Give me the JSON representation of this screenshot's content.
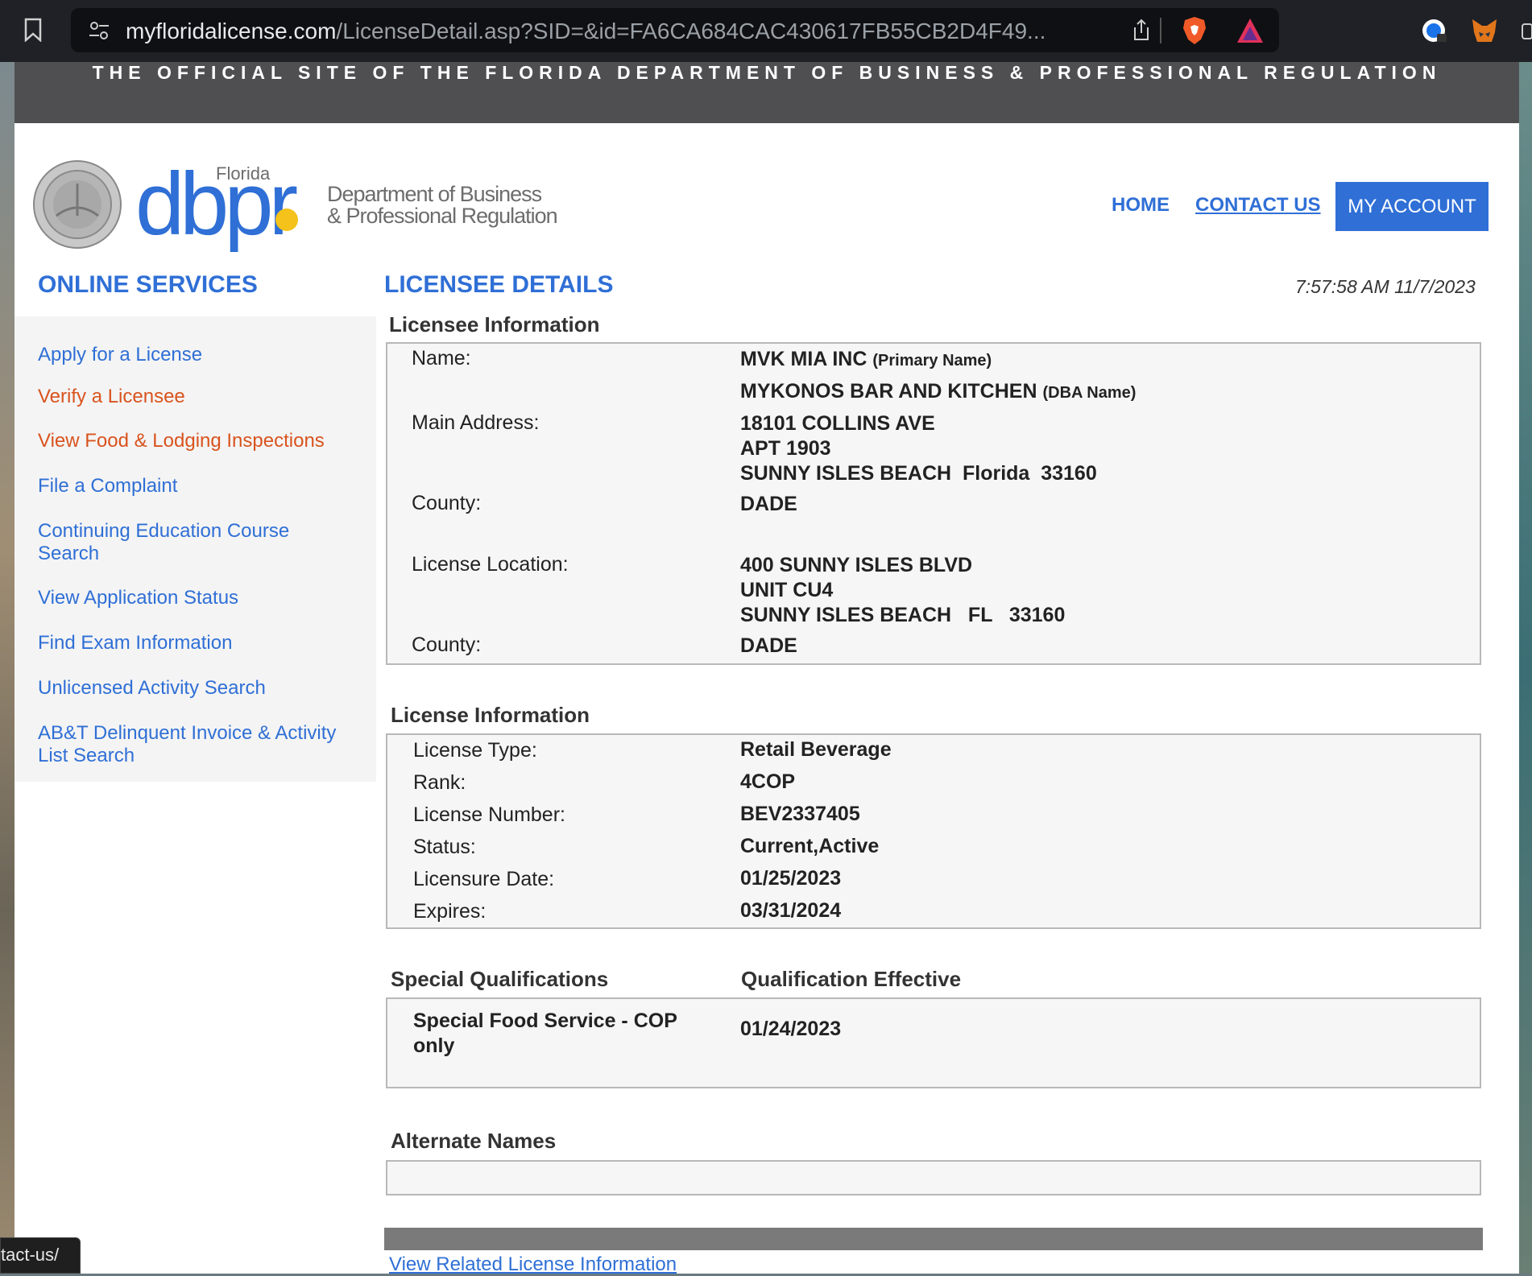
{
  "browser": {
    "url_domain": "myfloridalicense.com",
    "url_path": "/LicenseDetail.asp?SID=&id=FA6CA684CAC430617FB55CB2D4F49..."
  },
  "banner": "THE OFFICIAL SITE OF THE FLORIDA DEPARTMENT OF BUSINESS & PROFESSIONAL REGULATION",
  "header": {
    "logo_florida": "Florida",
    "logo_dbpr": "dbpr",
    "logo_line1": "Department of Business",
    "logo_line2": "& Professional Regulation",
    "nav_home": "HOME",
    "nav_contact": "CONTACT US",
    "nav_account": "MY ACCOUNT"
  },
  "sidebar": {
    "title": "ONLINE SERVICES",
    "items": [
      {
        "label": "Apply for a License"
      },
      {
        "label": "Verify a Licensee"
      },
      {
        "label": "View Food & Lodging Inspections"
      },
      {
        "label": "File a Complaint"
      },
      {
        "label": "Continuing Education Course Search"
      },
      {
        "label": "View Application Status"
      },
      {
        "label": "Find Exam Information"
      },
      {
        "label": "Unlicensed Activity Search"
      },
      {
        "label": "AB&T Delinquent Invoice & Activity List Search"
      }
    ]
  },
  "content": {
    "title": "LICENSEE DETAILS",
    "timestamp": "7:57:58 AM 11/7/2023",
    "licensee": {
      "heading": "Licensee Information",
      "name_label": "Name:",
      "primary_name": "MVK MIA INC",
      "primary_tag": "(Primary Name)",
      "dba_name": "MYKONOS BAR AND KITCHEN",
      "dba_tag": "(DBA Name)",
      "main_address_label": "Main Address:",
      "main_address_1": "18101 COLLINS AVE",
      "main_address_2": "APT 1903",
      "main_address_3": "SUNNY ISLES BEACH  Florida  33160",
      "county_label": "County:",
      "county": "DADE",
      "location_label": "License Location:",
      "location_1": "400 SUNNY ISLES BLVD",
      "location_2": "UNIT CU4",
      "location_3": "SUNNY ISLES BEACH   FL   33160",
      "county2_label": "County:",
      "county2": "DADE"
    },
    "license": {
      "heading": "License Information",
      "type_label": "License Type:",
      "type": "Retail Beverage",
      "rank_label": "Rank:",
      "rank": "4COP",
      "number_label": "License Number:",
      "number": "BEV2337405",
      "status_label": "Status:",
      "status": "Current,Active",
      "date_label": "Licensure Date:",
      "date": "01/25/2023",
      "expires_label": "Expires:",
      "expires": "03/31/2024"
    },
    "qualifications": {
      "heading": "Special Qualifications",
      "effective_heading": "Qualification Effective",
      "name": "Special Food Service - COP only",
      "effective": "01/24/2023"
    },
    "alternate": {
      "heading": "Alternate Names"
    },
    "related_link": "View Related License Information"
  },
  "status_tooltip": "tact-us/"
}
